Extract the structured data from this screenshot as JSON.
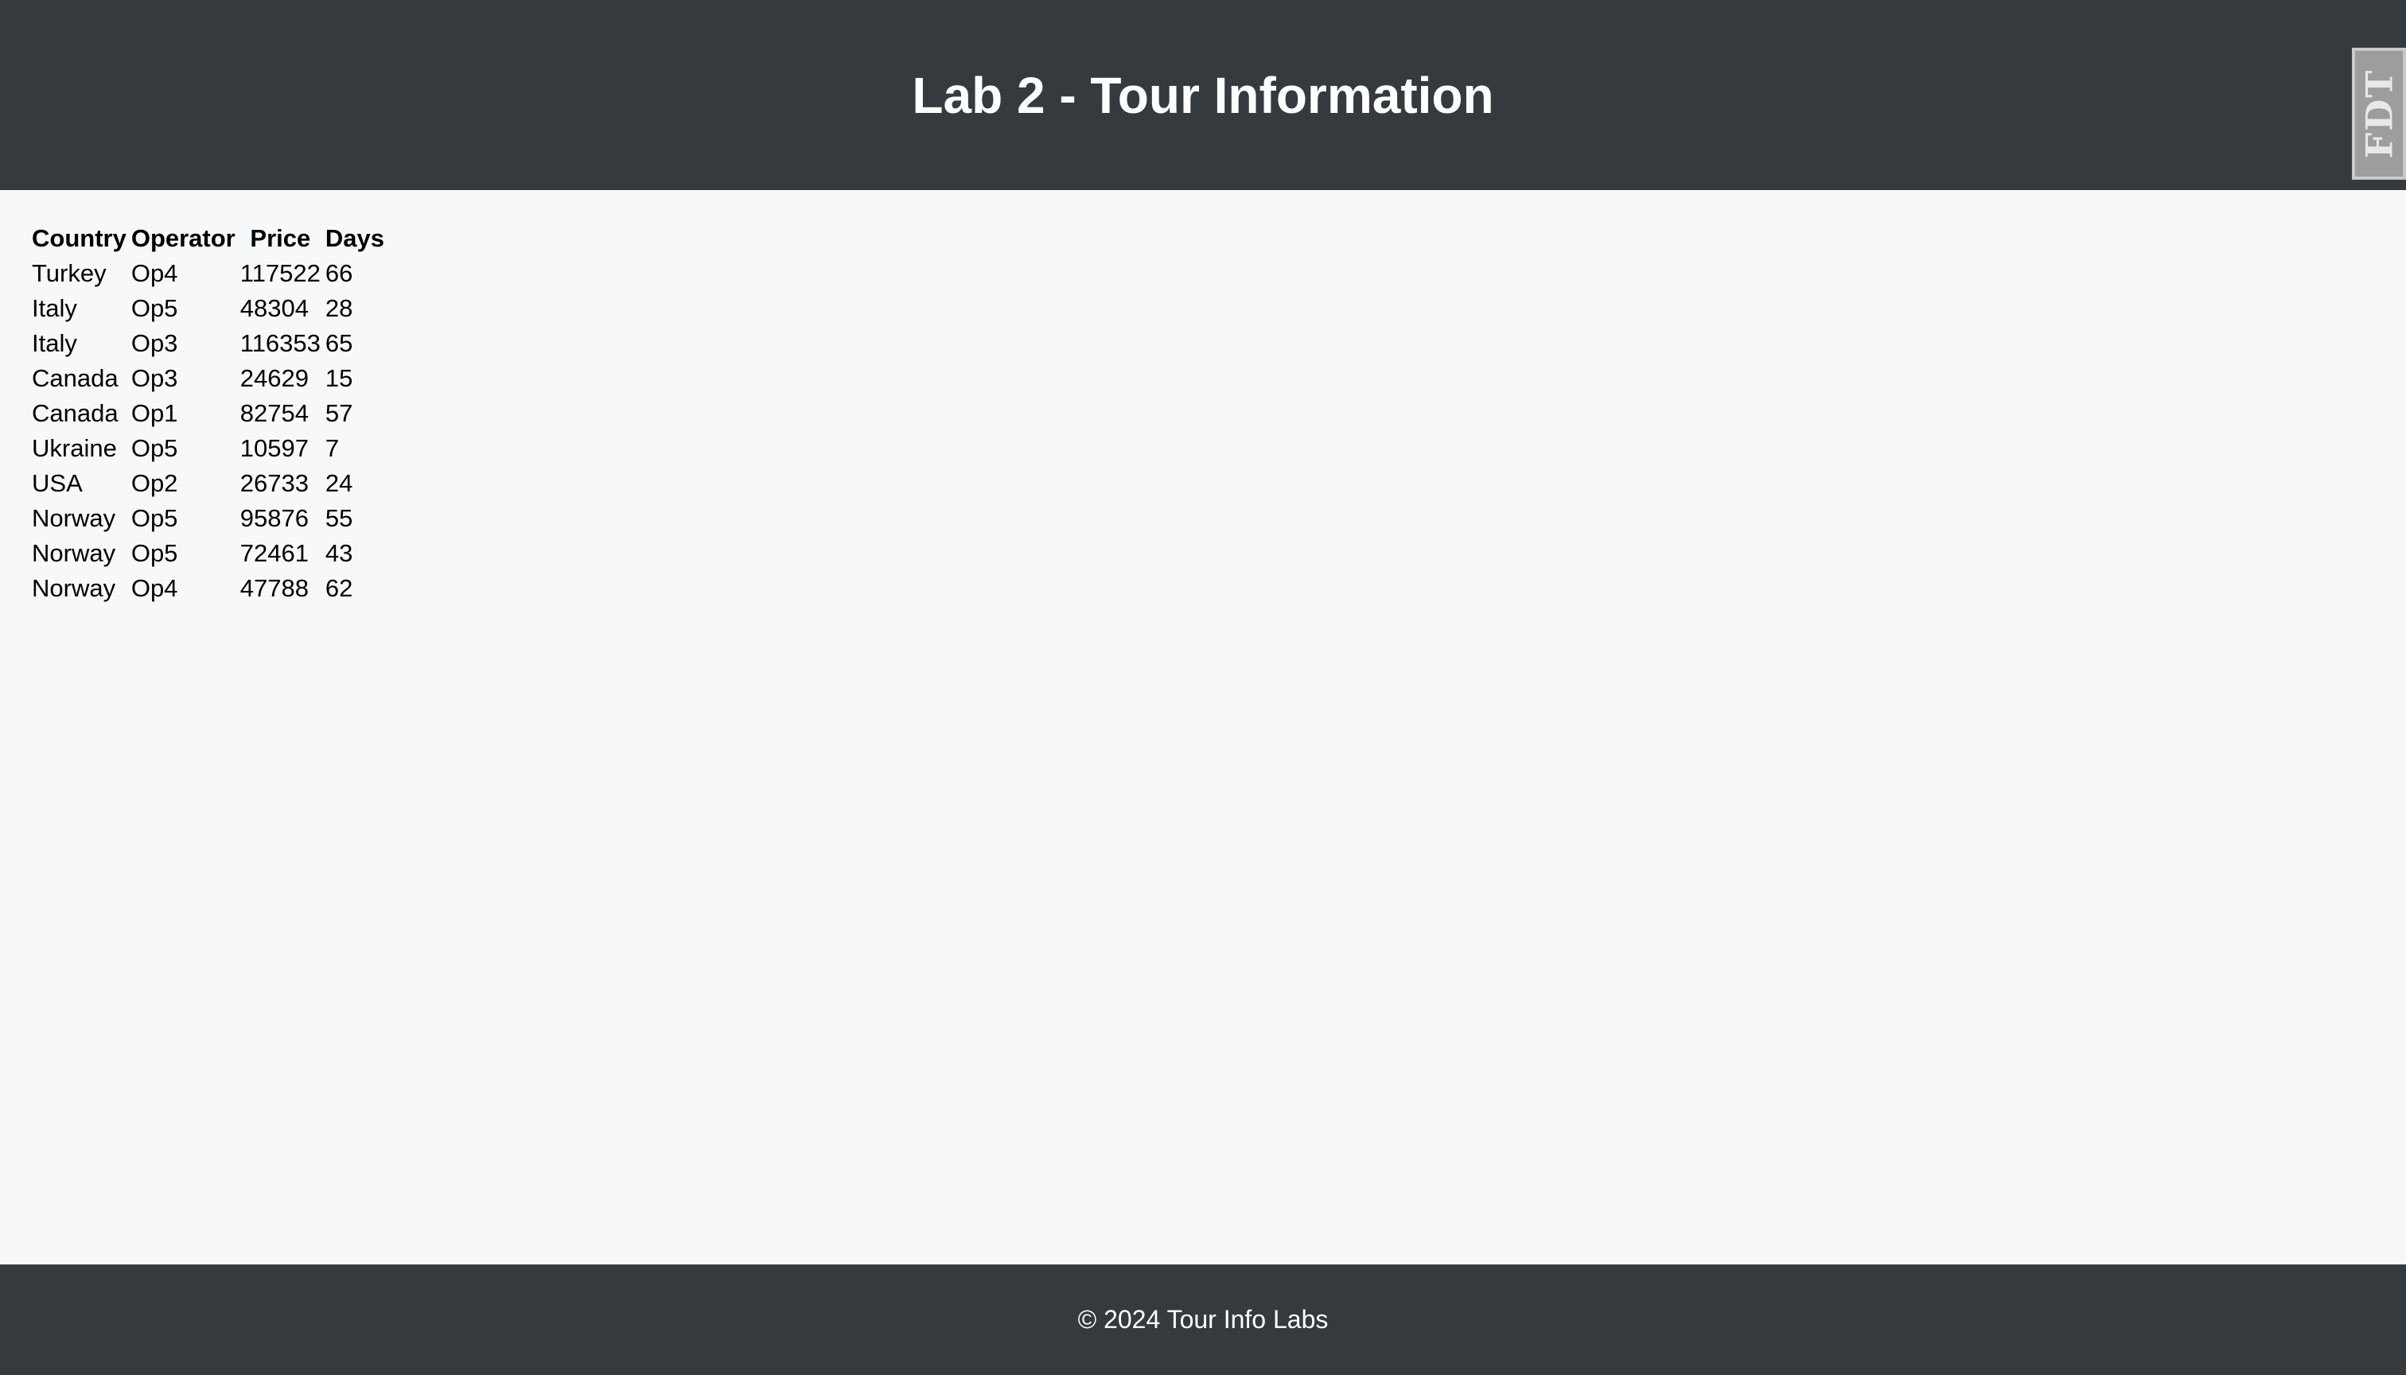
{
  "header": {
    "title": "Lab 2 - Tour Information",
    "badge_text": "FDT"
  },
  "table": {
    "columns": [
      "Country",
      "Operator",
      "Price",
      "Days"
    ],
    "rows": [
      [
        "Turkey",
        "Op4",
        "117522",
        "66"
      ],
      [
        "Italy",
        "Op5",
        "48304",
        "28"
      ],
      [
        "Italy",
        "Op3",
        "116353",
        "65"
      ],
      [
        "Canada",
        "Op3",
        "24629",
        "15"
      ],
      [
        "Canada",
        "Op1",
        "82754",
        "57"
      ],
      [
        "Ukraine",
        "Op5",
        "10597",
        "7"
      ],
      [
        "USA",
        "Op2",
        "26733",
        "24"
      ],
      [
        "Norway",
        "Op5",
        "95876",
        "55"
      ],
      [
        "Norway",
        "Op5",
        "72461",
        "43"
      ],
      [
        "Norway",
        "Op4",
        "47788",
        "62"
      ]
    ]
  },
  "footer": {
    "text": "© 2024 Tour Info Labs"
  },
  "colors": {
    "header_bg": "#353a3f",
    "page_bg": "#f7f8fa",
    "badge_bg": "#9d9d9d"
  }
}
